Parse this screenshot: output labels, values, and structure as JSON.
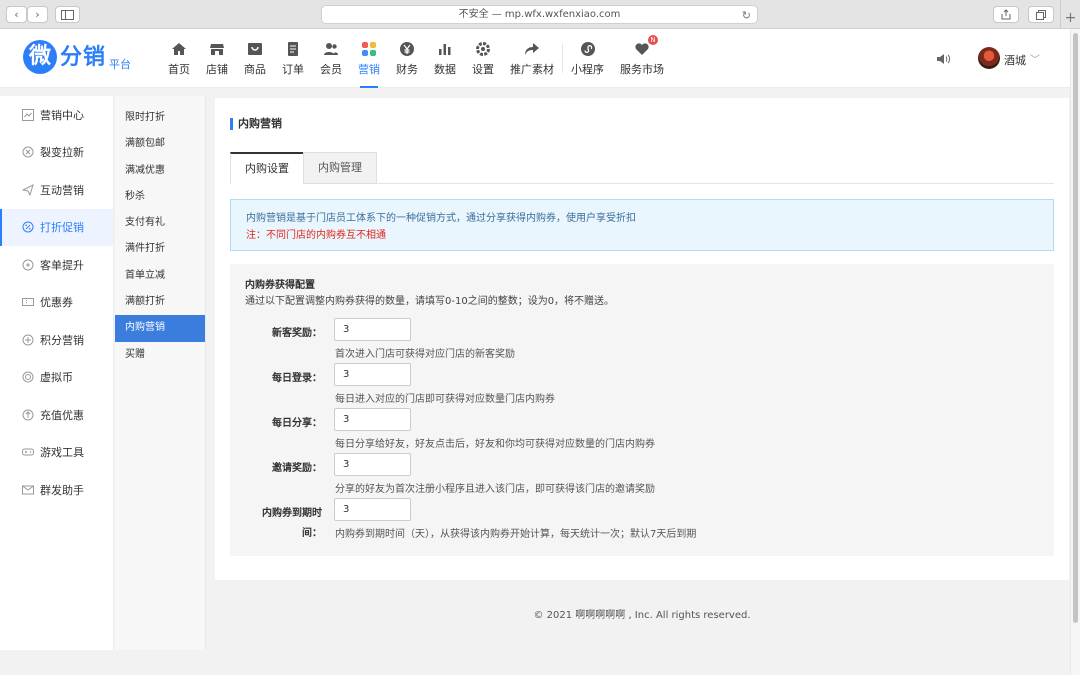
{
  "browser": {
    "url": "不安全 — mp.wfx.wxfenxiao.com"
  },
  "logo": {
    "mark": "微",
    "brand": "分销",
    "sub": "平台"
  },
  "topnav": [
    {
      "label": "首页",
      "icon": "home-icon"
    },
    {
      "label": "店铺",
      "icon": "store-icon"
    },
    {
      "label": "商品",
      "icon": "goods-icon"
    },
    {
      "label": "订单",
      "icon": "order-icon"
    },
    {
      "label": "会员",
      "icon": "member-icon"
    },
    {
      "label": "营销",
      "icon": "marketing-icon",
      "active": true
    },
    {
      "label": "财务",
      "icon": "finance-icon"
    },
    {
      "label": "数据",
      "icon": "data-icon"
    },
    {
      "label": "设置",
      "icon": "settings-icon"
    },
    {
      "label": "推广素材",
      "icon": "share-icon"
    },
    {
      "label": "小程序",
      "icon": "miniprogram-icon"
    },
    {
      "label": "服务市场",
      "icon": "service-market-icon",
      "badge": "N"
    }
  ],
  "user": {
    "name": "酒城"
  },
  "side_menu": [
    {
      "label": "营销中心",
      "icon": "chart-icon"
    },
    {
      "label": "裂变拉新",
      "icon": "fission-icon"
    },
    {
      "label": "互动营销",
      "icon": "paper-plane-icon"
    },
    {
      "label": "打折促销",
      "icon": "discount-icon",
      "active": true
    },
    {
      "label": "客单提升",
      "icon": "lift-icon"
    },
    {
      "label": "优惠券",
      "icon": "coupon-icon"
    },
    {
      "label": "积分营销",
      "icon": "points-icon"
    },
    {
      "label": "虚拟币",
      "icon": "coin-icon"
    },
    {
      "label": "充值优惠",
      "icon": "recharge-icon"
    },
    {
      "label": "游戏工具",
      "icon": "gamepad-icon"
    },
    {
      "label": "群发助手",
      "icon": "mail-icon"
    }
  ],
  "sub_menu": [
    {
      "label": "限时打折"
    },
    {
      "label": "满额包邮"
    },
    {
      "label": "满减优惠"
    },
    {
      "label": "秒杀"
    },
    {
      "label": "支付有礼"
    },
    {
      "label": "满件打折"
    },
    {
      "label": "首单立减"
    },
    {
      "label": "满额打折"
    },
    {
      "label": "内购营销",
      "active": true
    },
    {
      "label": "买赠"
    }
  ],
  "page": {
    "title": "内购营销",
    "tabs": [
      {
        "label": "内购设置",
        "active": true
      },
      {
        "label": "内购管理"
      }
    ],
    "notice": {
      "line1": "内购营销是基于门店员工体系下的一种促销方式，通过分享获得内购券，使用户享受折扣",
      "line2": "注：不同门店的内购券互不相通"
    },
    "config": {
      "heading": "内购券获得配置",
      "subheading": "通过以下配置调整内购券获得的数量，请填写0-10之间的整数；设为0，将不赠送。",
      "fields": [
        {
          "label": "新客奖励：",
          "value": "3",
          "hint": "首次进入门店可获得对应门店的新客奖励"
        },
        {
          "label": "每日登录：",
          "value": "3",
          "hint": "每日进入对应的门店即可获得对应数量门店内购券"
        },
        {
          "label": "每日分享：",
          "value": "3",
          "hint": "每日分享给好友，好友点击后，好友和你均可获得对应数量的门店内购券"
        },
        {
          "label": "邀请奖励：",
          "value": "3",
          "hint": "分享的好友为首次注册小程序且进入该门店，即可获得该门店的邀请奖励"
        },
        {
          "label": "内购券到期时",
          "label2": "间：",
          "value": "3",
          "hint": "内购券到期时间（天），从获得该内购券开始计算，每天统计一次；默认7天后到期"
        }
      ]
    }
  },
  "footer": "© 2021 啊啊啊啊啊 , Inc. All rights reserved."
}
